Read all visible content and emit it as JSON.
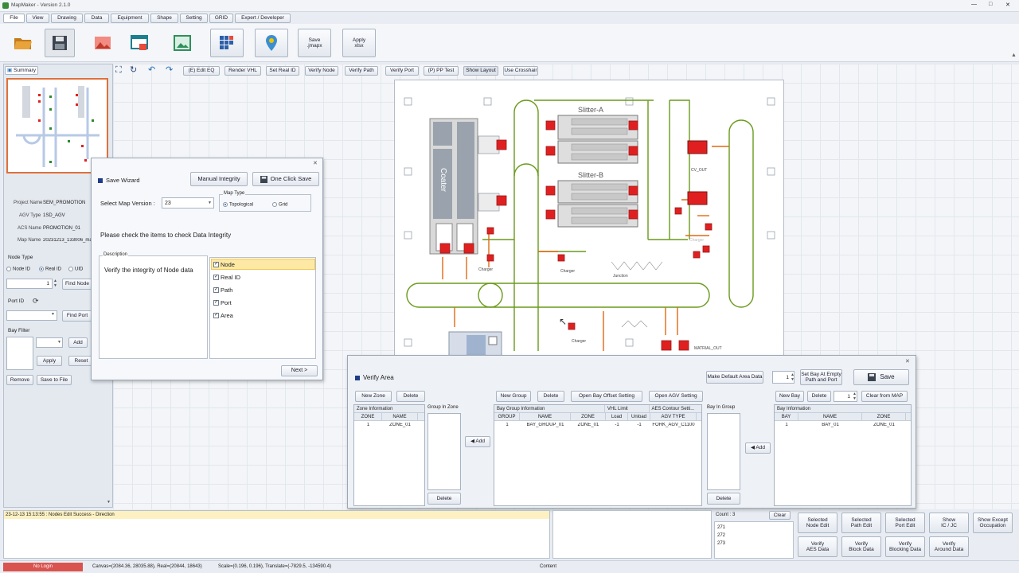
{
  "app": {
    "title": "MapMaker - Version 2.1.0",
    "window_controls": [
      "—",
      "□",
      "✕"
    ]
  },
  "menu_tabs": [
    {
      "label": "File"
    },
    {
      "label": "View"
    },
    {
      "label": "Drawing"
    },
    {
      "label": "Data"
    },
    {
      "label": "Equipment"
    },
    {
      "label": "Shape"
    },
    {
      "label": "Setting"
    },
    {
      "label": "GRID"
    },
    {
      "label": "Expert / Developer"
    }
  ],
  "ribbon": {
    "save_jmapx_line1": "Save",
    "save_jmapx_line2": ".jmapx",
    "apply_xlsx_line1": "Apply",
    "apply_xlsx_line2": "xlsx",
    "icons": [
      "open-folder-icon",
      "save-disk-icon",
      "image-icon",
      "window-icon",
      "picture-icon",
      "grid-icon",
      "map-pin-icon"
    ]
  },
  "toolbar": {
    "buttons": [
      "(E) Edit EQ",
      "Render VHL",
      "Set Real ID",
      "Verify Node",
      "Verify Path",
      "Verify Port",
      "(P) PP Test",
      "Show Layout",
      "Use Crosshair"
    ]
  },
  "left_panel": {
    "summary_tab": "Summary",
    "project_label": "Project Name",
    "project_value": "SEM_PROMOTION",
    "agv_label": "AGV Type",
    "agv_value": "1SD_AGV",
    "acs_label": "ACS Name",
    "acs_value": "PROMOTION_01",
    "map_label": "Map Name",
    "map_value": "20231213_133006_map",
    "node_type_label": "Node Type",
    "node_id_option": "Node ID",
    "real_id_option": "Real ID",
    "uid_option": "UID",
    "node_number": "1",
    "find_node": "Find Node",
    "port_id_label": "Port ID",
    "find_port": "Find Port",
    "bay_filter_label": "Bay Filter",
    "add_label": "Add",
    "apply_label": "Apply",
    "reset_label": "Reset",
    "remove_label": "Remove",
    "save_to_file_label": "Save to File"
  },
  "save_wizard": {
    "title": "Save Wizard",
    "manual_integrity": "Manual Integrity",
    "one_click_save": "One Click Save",
    "select_version_label": "Select Map Version :",
    "version_value": "23",
    "map_type_label": "Map Type",
    "topological": "Topological",
    "grid": "Grid",
    "instruction": "Please check the items to check Data Integrity",
    "description_label": "Description",
    "description_text": "Verify the integrity of Node data",
    "items": [
      "Node",
      "Real ID",
      "Path",
      "Port",
      "Area"
    ],
    "next": "Next >"
  },
  "map": {
    "slitter_a": "Slitter-A",
    "slitter_b": "Slitter-B",
    "coater": "Coater",
    "cv_out": "CV_OUT",
    "charger": "Charger",
    "junction": "Junction",
    "material_out": "MATRIAL_OUT",
    "faint_label": "Charger"
  },
  "verify_area": {
    "title": "Verify Area",
    "make_default": "Make Default Area Data",
    "spinner_value": "1",
    "set_bay_line1": "Set Bay At Empty",
    "set_bay_line2": "Path and Port",
    "save": "Save",
    "new_zone": "New Zone",
    "delete": "Delete",
    "new_group": "New Group",
    "open_bay_offset": "Open Bay Offset Setting",
    "open_agv": "Open AGV Setting",
    "new_bay": "New Bay",
    "clear_from_map": "Clear from MAP",
    "zone_info": "Zone Information",
    "zone_cols": [
      "ZONE",
      "NAME"
    ],
    "zone_row": [
      "1",
      "ZONE_01"
    ],
    "group_in_zone": "Group In Zone",
    "add_arrow": "◀ Add",
    "bay_group_info": "Bay Group Information",
    "vhl_limit": "VHL Limit",
    "aes_contour": "AES Contour Setti...",
    "group_cols": [
      "GROUP",
      "NAME",
      "ZONE",
      "Load",
      "Unload",
      "AGV TYPE"
    ],
    "group_row": [
      "1",
      "BAY_GROUP_01",
      "ZONE_01",
      "-1",
      "-1",
      "FORK_AGV_C1100"
    ],
    "bay_in_group": "Bay In Group",
    "bay_info": "Bay Information",
    "bay_cols": [
      "BAY",
      "NAME",
      "ZONE"
    ],
    "bay_row": [
      "1",
      "BAY_01",
      "ZONE_01"
    ]
  },
  "log": {
    "message": "23-12-13 15:13:55 : Nodes Edit Success - Direction"
  },
  "count_panel": {
    "label": "Count : 3",
    "clear": "Clear",
    "items": [
      "271",
      "272",
      "273"
    ]
  },
  "bottom_buttons": [
    [
      "Selected",
      "Node Edit"
    ],
    [
      "Selected",
      "Path Edit"
    ],
    [
      "Selected",
      "Port Edit"
    ],
    [
      "Show",
      "IC / JC"
    ],
    [
      "Show Except",
      "Occupation"
    ],
    [
      "Verify",
      "AES Data"
    ],
    [
      "Verify",
      "Block Data"
    ],
    [
      "Verify",
      "Blocking Data"
    ],
    [
      "Verify",
      "Around Data"
    ]
  ],
  "status": {
    "login": "No Login",
    "canvas": "Canvas=(2084.36, 28035.88), Real=(20844, 18643)",
    "scale": "Scale=(0.196, 0.196), Translate=(-7829.5, -134590.4)",
    "content": "Content"
  },
  "colors": {
    "red": "#e02020",
    "dark_red": "#9a1a1a",
    "path_green": "#6a9a1a",
    "orange": "#e06a10",
    "status_red": "#d9534f",
    "accent": "#1f3c88"
  }
}
